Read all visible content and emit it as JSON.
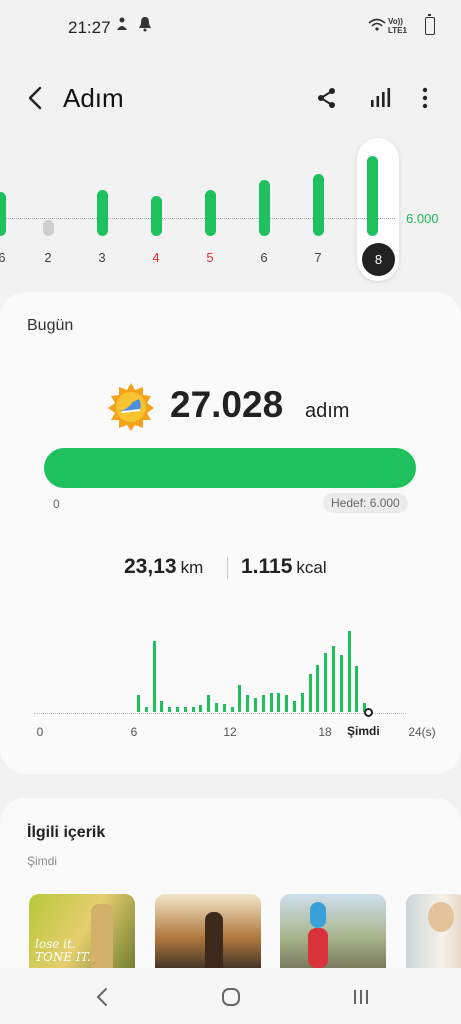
{
  "status_bar": {
    "time": "21:27",
    "network_top": "Vo))",
    "network_bottom": "LTE1"
  },
  "header": {
    "title": "Adım",
    "icons": [
      "back-arrow",
      "share",
      "bar-chart",
      "more-vertical"
    ]
  },
  "week_chart": {
    "target_label": "6.000",
    "days": [
      {
        "label": "/6",
        "steps_fraction": 0.55,
        "red": false
      },
      {
        "label": "2",
        "steps_fraction": 0.0,
        "red": false
      },
      {
        "label": "3",
        "steps_fraction": 0.58,
        "red": false
      },
      {
        "label": "4",
        "steps_fraction": 0.5,
        "red": false
      },
      {
        "label": "5",
        "steps_fraction": 0.58,
        "red": false
      },
      {
        "label": "6",
        "steps_fraction": 0.7,
        "red": false
      },
      {
        "label": "7",
        "steps_fraction": 0.77,
        "red": false
      },
      {
        "label": "8",
        "steps_fraction": 1.0,
        "red": false,
        "selected": true
      }
    ],
    "red_days": [
      "4",
      "5"
    ]
  },
  "today": {
    "label": "Bugün",
    "steps": "27.028",
    "steps_unit": "adım",
    "progress_percent": 100,
    "progress_min": "0",
    "progress_goal": "Hedef: 6.000",
    "distance_value": "23,13",
    "distance_unit": "km",
    "kcal_value": "1.115",
    "kcal_unit": "kcal"
  },
  "hourly_chart": {
    "x_labels": [
      "0",
      "6",
      "12",
      "18",
      "24(s)"
    ],
    "now_label": "Şimdi",
    "bars": [
      0.18,
      0.05,
      0.75,
      0.12,
      0.05,
      0.05,
      0.05,
      0.05,
      0.07,
      0.18,
      0.1,
      0.08,
      0.05,
      0.28,
      0.18,
      0.15,
      0.18,
      0.2,
      0.2,
      0.18,
      0.12,
      0.2,
      0.4,
      0.5,
      0.62,
      0.7,
      0.6,
      0.85,
      0.48,
      0.1
    ]
  },
  "related": {
    "title": "İlgili içerik",
    "subtitle": "Şimdi",
    "thumb1_text_line1": "lose it.",
    "thumb1_text_line2": "TONE IT."
  },
  "colors": {
    "accent": "#1fc15f",
    "background": "#f2f2f2",
    "card": "#fafafa",
    "weekend": "#d33"
  }
}
